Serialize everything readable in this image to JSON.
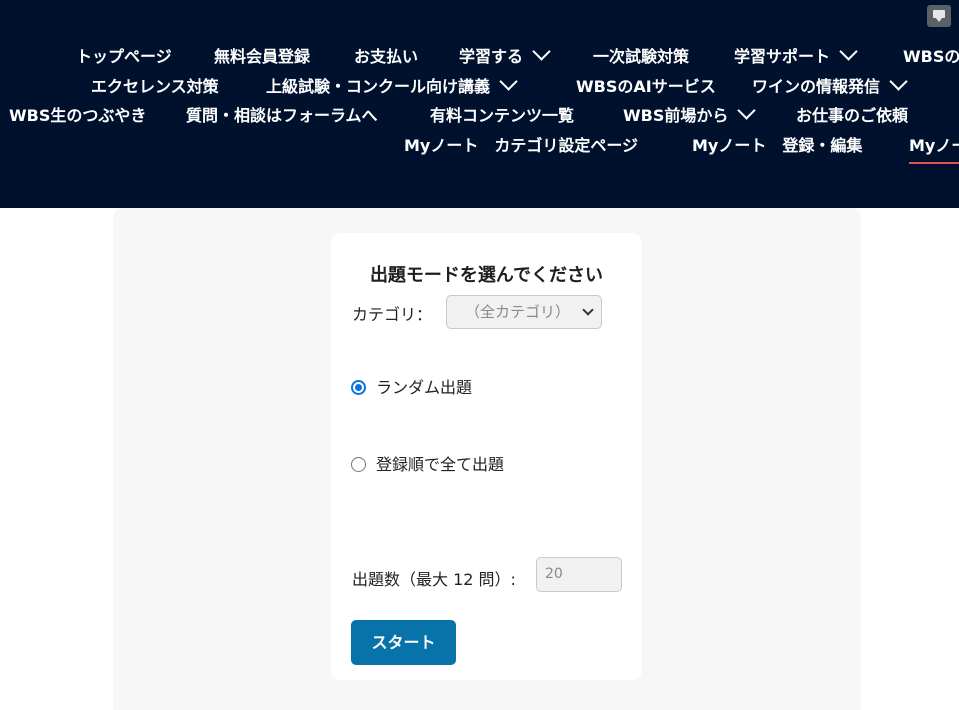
{
  "nav": {
    "row1": [
      "トップページ",
      "無料会員登録",
      "お支払い",
      "学習する",
      "一次試験対策",
      "学習サポート",
      "WBSの"
    ],
    "row2": [
      "エクセレンス対策",
      "上級試験・コンクール向け講義",
      "WBSのAIサービス",
      "ワインの情報発信"
    ],
    "row3": [
      "WBS生のつぶやき",
      "質問・相談はフォーラムへ",
      "有料コンテンツ一覧",
      "WBS前場から",
      "お仕事のご依頼"
    ],
    "row4": [
      "Myノート　カテゴリ設定ページ",
      "Myノート　登録・編集",
      "Myノー"
    ]
  },
  "form": {
    "title": "出題モードを選んでください",
    "category_label": "カテゴリ：",
    "category_selected": "（全カテゴリ）",
    "mode_random": "ランダム出題",
    "mode_sequential": "登録順で全て出題",
    "selected_mode": "random",
    "count_label": "出題数（最大 12 問）:",
    "count_value": "20",
    "start_label": "スタート"
  },
  "colors": {
    "header_bg": "#00112e",
    "accent": "#0773a8",
    "radio": "#0a74da",
    "active_underline": "#e05260"
  }
}
